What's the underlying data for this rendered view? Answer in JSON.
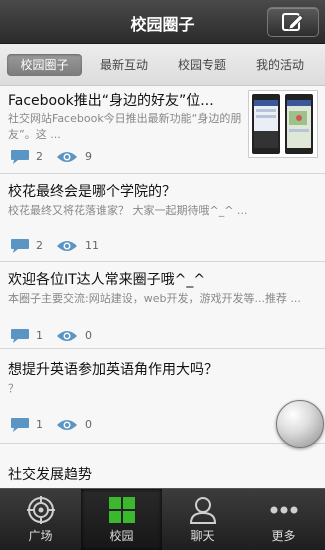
{
  "header": {
    "title": "校园圈子",
    "compose_icon": "compose-edit-icon"
  },
  "tabs": [
    {
      "label": "校园圈子",
      "active": true
    },
    {
      "label": "最新互动",
      "active": false
    },
    {
      "label": "校园专题",
      "active": false
    },
    {
      "label": "我的活动",
      "active": false
    }
  ],
  "posts": [
    {
      "title": "Facebook推出“身边的好友”位...",
      "summary": "社交网站Facebook今日推出最新功能“身边的朋友”。这 ...",
      "comments": "2",
      "views": "9",
      "has_thumb": true
    },
    {
      "title": "校花最终会是哪个学院的？",
      "summary": "校花最终又将花落谁家？ 大家一起期待哦^_^ ...",
      "comments": "2",
      "views": "11",
      "has_thumb": false
    },
    {
      "title": "欢迎各位IT达人常来圈子哦^_^",
      "summary": "本圈子主要交流:网站建设，web开发，游戏开发等...推荐 ...",
      "comments": "1",
      "views": "0",
      "has_thumb": false
    },
    {
      "title": "想提升英语参加英语角作用大吗？",
      "summary": "？",
      "comments": "1",
      "views": "0",
      "has_thumb": false
    },
    {
      "title": "社交发展趋势",
      "summary": "",
      "comments": "",
      "views": "",
      "has_thumb": false
    }
  ],
  "bottom_nav": [
    {
      "label": "广场",
      "icon": "plaza-target-icon",
      "active": false
    },
    {
      "label": "校园",
      "icon": "campus-grid-icon",
      "active": true
    },
    {
      "label": "聊天",
      "icon": "chat-person-icon",
      "active": false
    },
    {
      "label": "更多",
      "icon": "more-dots-icon",
      "active": false
    }
  ],
  "colors": {
    "accent_green": "#3cb82e",
    "icon_blue": "#5a95c4"
  }
}
